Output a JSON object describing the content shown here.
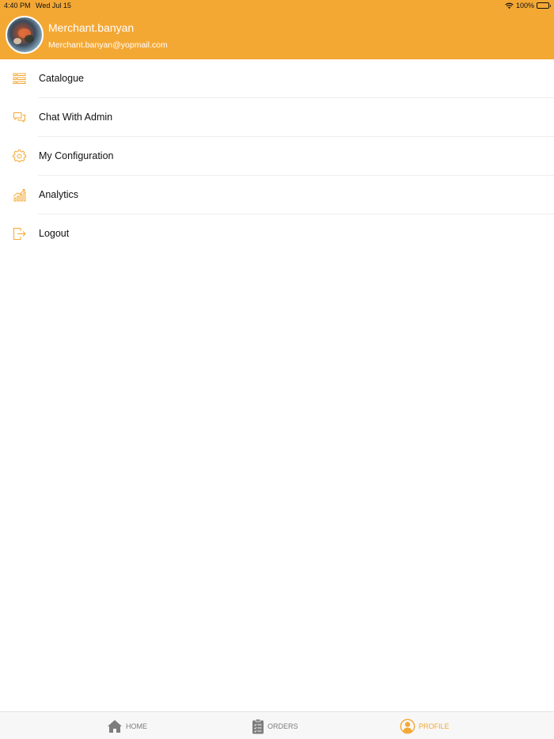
{
  "status_bar": {
    "time": "4:40 PM",
    "date": "Wed Jul 15",
    "battery": "100%"
  },
  "header": {
    "user_name": "Merchant.banyan",
    "user_email": "Merchant.banyan@yopmail.com"
  },
  "menu": {
    "items": [
      {
        "label": "Catalogue",
        "icon": "list-icon"
      },
      {
        "label": "Chat With Admin",
        "icon": "chat-icon"
      },
      {
        "label": "My Configuration",
        "icon": "gear-icon"
      },
      {
        "label": "Analytics",
        "icon": "analytics-icon"
      },
      {
        "label": "Logout",
        "icon": "logout-icon"
      }
    ]
  },
  "tabbar": {
    "tabs": [
      {
        "label": "HOME",
        "icon": "home-icon",
        "active": false
      },
      {
        "label": "ORDERS",
        "icon": "orders-icon",
        "active": false
      },
      {
        "label": "PROFILE",
        "icon": "profile-icon",
        "active": true
      }
    ]
  },
  "colors": {
    "accent": "#F4A834",
    "tab_inactive": "#7D7D7D",
    "text": "#111111"
  }
}
